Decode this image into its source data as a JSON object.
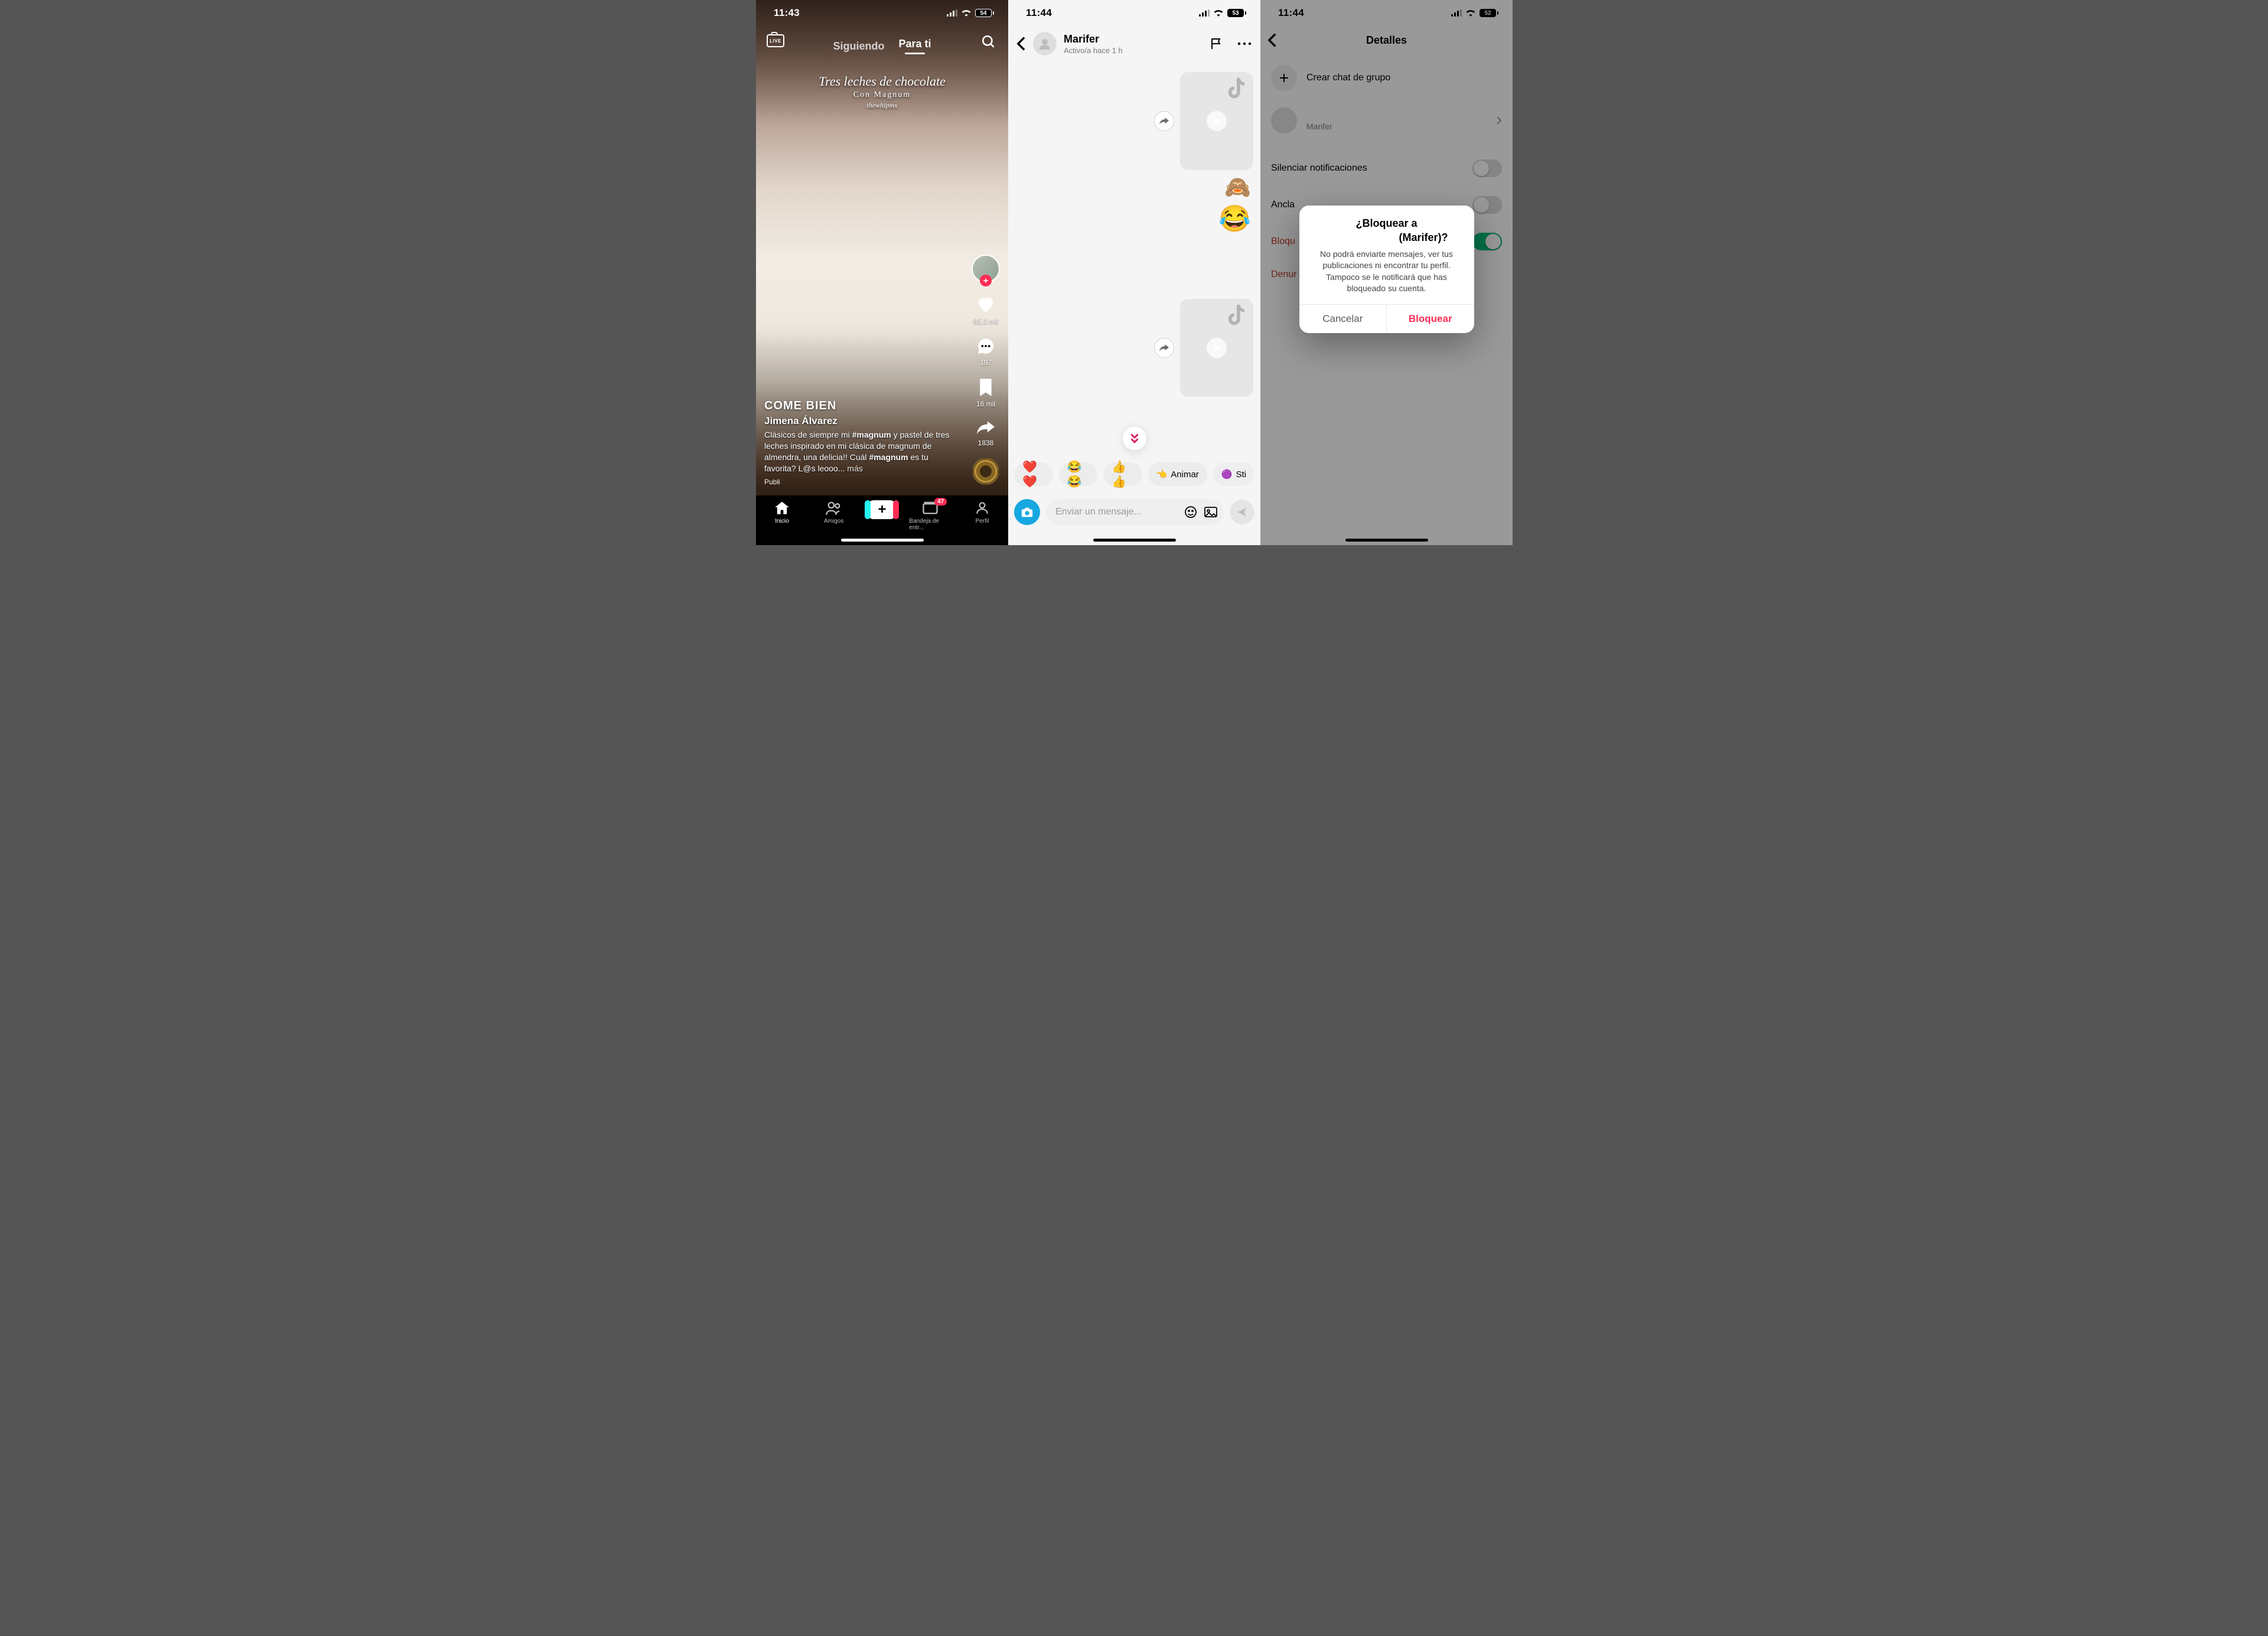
{
  "phone1": {
    "status": {
      "time": "11:43",
      "battery": "54"
    },
    "topbar": {
      "live": "LIVE",
      "following": "Siguiendo",
      "for_you": "Para ti"
    },
    "overlay": {
      "line1": "Tres leches de chocolate",
      "line2": "Con Magnum",
      "line3": "thewhipmx"
    },
    "caption": {
      "come_bien": "COME BIEN",
      "user": "Jimena Álvarez",
      "desc_before": "Clásicos de siempre mi ",
      "hash1": "#magnum",
      "desc_mid": " y pastel de tres leches inspirado en mi clásica de magnum de almendra, una delicia!! Cuál ",
      "hash2": "#magnum",
      "desc_after": " es tu favorita? L@s leooo... ",
      "more": "más",
      "publi": "Publi"
    },
    "rail": {
      "likes": "85,3 mil",
      "comments": "197",
      "saves": "16 mil",
      "shares": "1838"
    },
    "nav": {
      "home": "Inicio",
      "friends": "Amigos",
      "inbox": "Bandeja de entr...",
      "inbox_badge": "47",
      "profile": "Perfil"
    }
  },
  "phone2": {
    "status": {
      "time": "11:44",
      "battery": "53"
    },
    "header": {
      "name": "Marifer",
      "sub": "Activo/a hace 1 h"
    },
    "reactions": {
      "monkey": "🙈",
      "laugh": "😂"
    },
    "quick": {
      "hearts": "❤️❤️",
      "laughs": "😂😂",
      "thumbs": "👍👍",
      "animar_icon": "👈",
      "animar": "Animar",
      "sticker_icon": "🟣",
      "sticker": "Sti"
    },
    "input": {
      "placeholder": "Enviar un mensaje..."
    }
  },
  "phone3": {
    "status": {
      "time": "11:44",
      "battery": "52"
    },
    "header": {
      "title": "Detalles"
    },
    "rows": {
      "create_group": "Crear chat de grupo",
      "member_sub": "Marifer",
      "mute": "Silenciar notificaciones",
      "pin": "Ancla",
      "block": "Bloqu",
      "report": "Denur"
    },
    "modal": {
      "title_l1": "¿Bloquear a",
      "title_l2": "(Marifer)?",
      "msg": "No podrá enviarte mensajes, ver tus publicaciones ni encontrar tu perfil. Tampoco se le notificará que has bloqueado su cuenta.",
      "cancel": "Cancelar",
      "block": "Bloquear"
    }
  }
}
